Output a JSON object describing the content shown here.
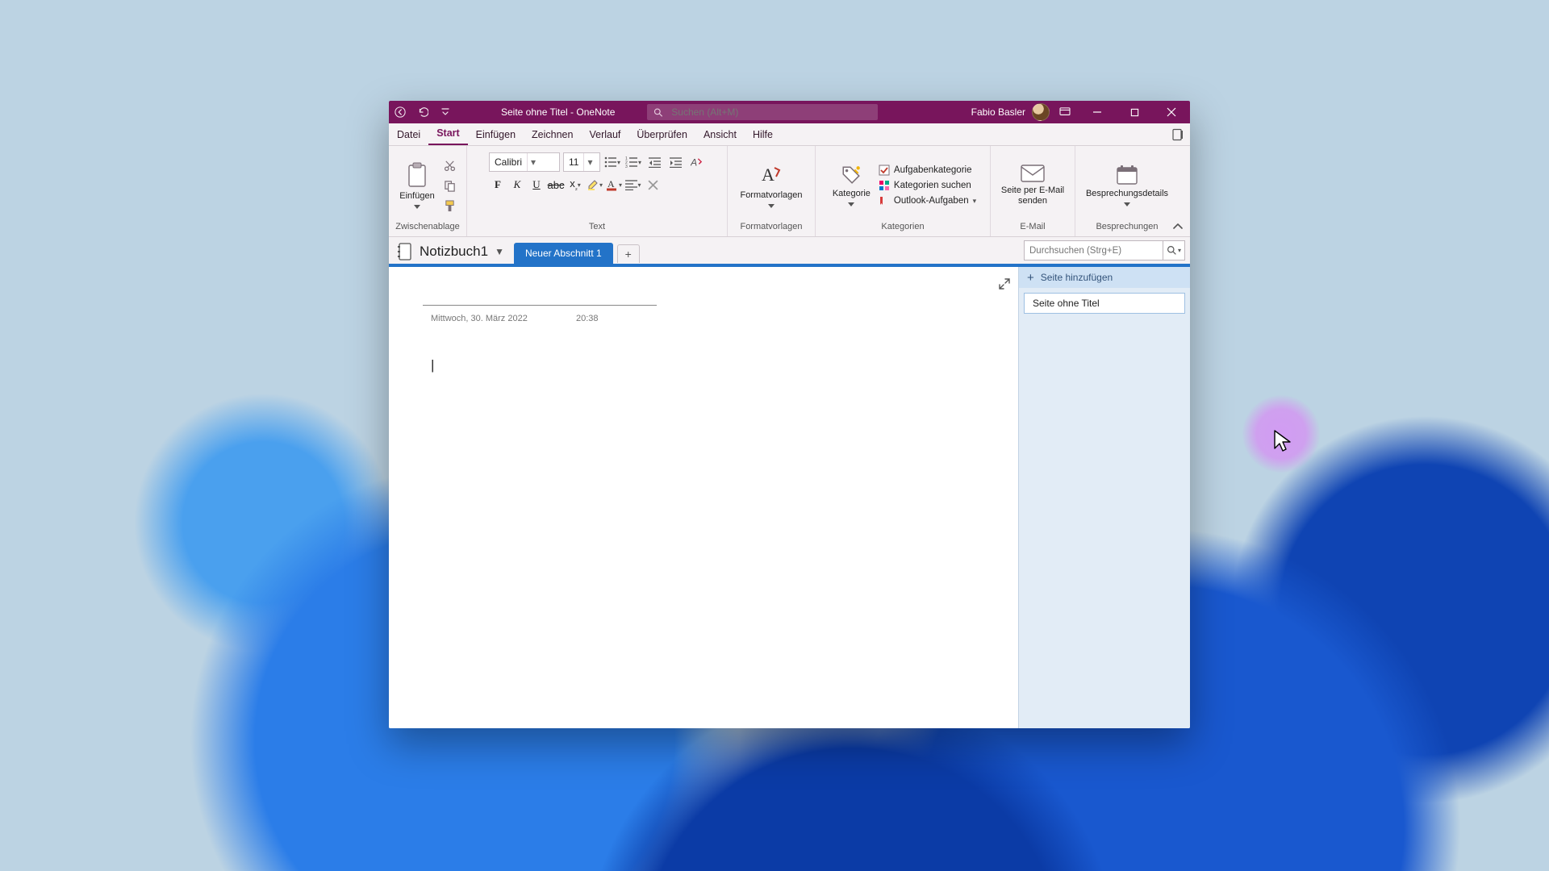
{
  "accent": "#78155c",
  "section_color": "#2373c8",
  "titlebar": {
    "doc": "Seite ohne Titel",
    "app": "OneNote",
    "full": "Seite ohne Titel  -  OneNote",
    "search_placeholder": "Suchen (Alt+M)",
    "user": "Fabio Basler"
  },
  "menu": {
    "datei": "Datei",
    "start": "Start",
    "einfuegen": "Einfügen",
    "zeichnen": "Zeichnen",
    "verlauf": "Verlauf",
    "ueberpruefen": "Überprüfen",
    "ansicht": "Ansicht",
    "hilfe": "Hilfe"
  },
  "ribbon": {
    "zwischenablage": {
      "label": "Zwischenablage",
      "einfuegen": "Einfügen"
    },
    "text": {
      "label": "Text",
      "font_name": "Calibri",
      "font_size": "11"
    },
    "formatvorlagen": {
      "label": "Formatvorlagen",
      "btn": "Formatvorlagen"
    },
    "kategorien": {
      "label": "Kategorien",
      "kategorie": "Kategorie",
      "aufgabenkategorie": "Aufgabenkategorie",
      "suchen": "Kategorien suchen",
      "outlook": "Outlook-Aufgaben"
    },
    "email": {
      "label": "E-Mail",
      "btn": "Seite per E-Mail senden"
    },
    "besprechungen": {
      "label": "Besprechungen",
      "btn": "Besprechungsdetails"
    }
  },
  "notebook": {
    "name": "Notizbuch1",
    "section": "Neuer Abschnitt 1",
    "search_placeholder": "Durchsuchen (Strg+E)"
  },
  "page": {
    "date": "Mittwoch, 30. März 2022",
    "time": "20:38"
  },
  "pagelist": {
    "add": "Seite hinzufügen",
    "items": [
      "Seite ohne Titel"
    ]
  }
}
